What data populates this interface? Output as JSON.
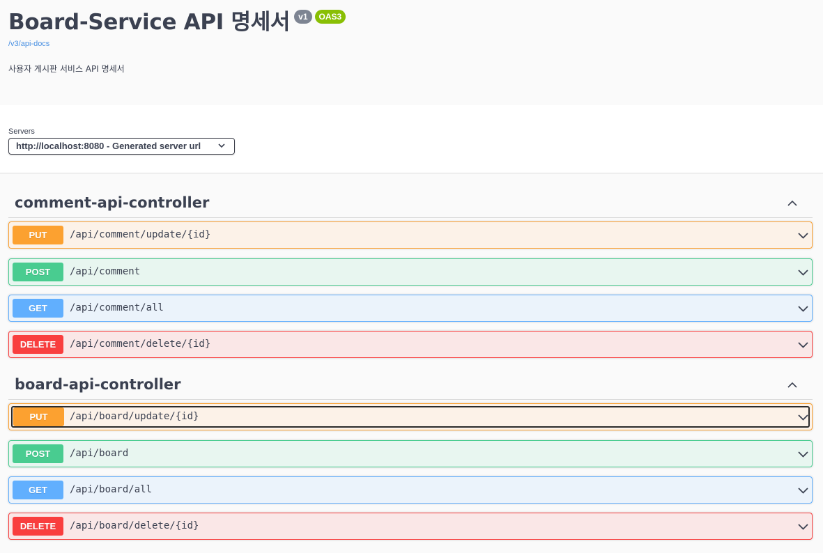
{
  "info": {
    "title": "Board-Service API 명세서",
    "version_badge": "v1",
    "oas_badge": "OAS3",
    "docs_link": "/v3/api-docs",
    "description": "사용자 게시판 서비스 API 명세서"
  },
  "servers": {
    "label": "Servers",
    "selected": "http://localhost:8080 - Generated server url"
  },
  "tags": [
    {
      "name": "comment-api-controller",
      "operations": [
        {
          "method": "PUT",
          "path": "/api/comment/update/{id}"
        },
        {
          "method": "POST",
          "path": "/api/comment"
        },
        {
          "method": "GET",
          "path": "/api/comment/all"
        },
        {
          "method": "DELETE",
          "path": "/api/comment/delete/{id}"
        }
      ]
    },
    {
      "name": "board-api-controller",
      "operations": [
        {
          "method": "PUT",
          "path": "/api/board/update/{id}"
        },
        {
          "method": "POST",
          "path": "/api/board"
        },
        {
          "method": "GET",
          "path": "/api/board/all"
        },
        {
          "method": "DELETE",
          "path": "/api/board/delete/{id}"
        }
      ]
    }
  ],
  "colors": {
    "put": "#fca130",
    "post": "#49cc90",
    "get": "#61affe",
    "delete": "#f93e3e",
    "oas_badge": "#89bf04",
    "version_badge": "#7d8492"
  },
  "icons": {
    "tag_toggle": "chevron-up-icon",
    "operation_expand": "chevron-down-icon",
    "server_select": "chevron-down-icon"
  }
}
